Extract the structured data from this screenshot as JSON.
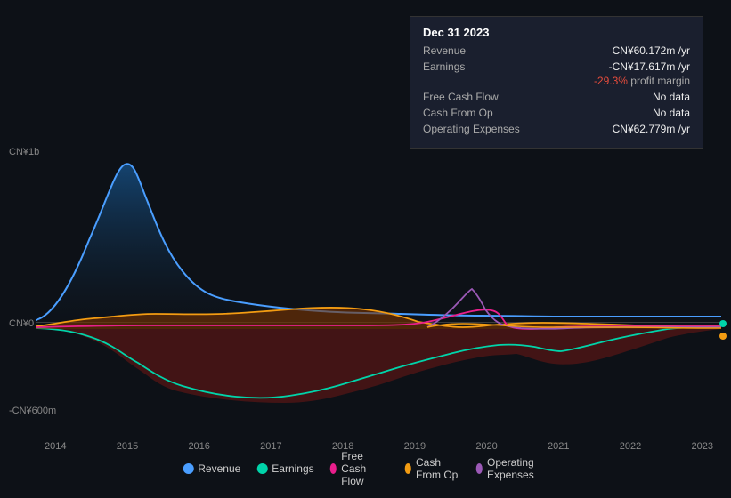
{
  "tooltip": {
    "date": "Dec 31 2023",
    "rows": [
      {
        "label": "Revenue",
        "value": "CN¥60.172m /yr",
        "valueClass": "value-blue"
      },
      {
        "label": "Earnings",
        "value": "-CN¥17.617m /yr",
        "valueClass": "value-red"
      },
      {
        "label": "",
        "value": "-29.3% profit margin",
        "valueClass": "value-red",
        "isMargin": true
      },
      {
        "label": "Free Cash Flow",
        "value": "No data",
        "valueClass": "value-nodata"
      },
      {
        "label": "Cash From Op",
        "value": "No data",
        "valueClass": "value-nodata"
      },
      {
        "label": "Operating Expenses",
        "value": "CN¥62.779m /yr",
        "valueClass": "value-cyan"
      }
    ]
  },
  "chart": {
    "yLabelTop": "CN¥1b",
    "yLabelZero": "CN¥0",
    "yLabelBottom": "-CN¥600m",
    "xLabels": [
      "2014",
      "2015",
      "2016",
      "2017",
      "2018",
      "2019",
      "2020",
      "2021",
      "2022",
      "2023"
    ]
  },
  "legend": [
    {
      "id": "revenue",
      "label": "Revenue",
      "color": "#4a9eff"
    },
    {
      "id": "earnings",
      "label": "Earnings",
      "color": "#00d4aa"
    },
    {
      "id": "free-cash-flow",
      "label": "Free Cash Flow",
      "color": "#e91e8c"
    },
    {
      "id": "cash-from-op",
      "label": "Cash From Op",
      "color": "#f39c12"
    },
    {
      "id": "operating-expenses",
      "label": "Operating Expenses",
      "color": "#9b59b6"
    }
  ]
}
